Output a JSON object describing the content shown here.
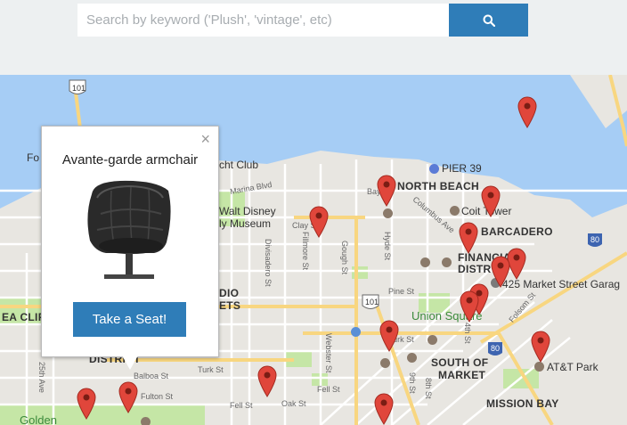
{
  "search": {
    "placeholder": "Search by keyword ('Plush', 'vintage', etc)",
    "button_icon": "search-icon"
  },
  "popup": {
    "title": "Avante-garde armchair",
    "button_label": "Take a Seat!",
    "close_glyph": "×",
    "image_icon": "armchair-image"
  },
  "map": {
    "pin_color": "#e0463b",
    "water_color": "#a6cdf5",
    "park_color": "#c5e6a6",
    "labels": {
      "pier39": "PIER 39",
      "north_beach": "NORTH BEACH",
      "coit_tower": "Coit Tower",
      "embarcadero": "BARCADERO",
      "financial": "FINANCIAL",
      "financial2": "DISTR",
      "market": "425 Market Street Garag",
      "union_square": "Union Square",
      "south_of_market": "SOUTH OF",
      "south_of_market2": "MARKET",
      "att_park": "AT&T Park",
      "mission_bay": "MISSION BAY",
      "walt_disney": "Walt Disney",
      "museum": "ly Museum",
      "yacht_club": "cht Club",
      "marina": "Marina Blvd",
      "clay": "Clay St",
      "pine": "Pine St",
      "turk_left": "Turk St",
      "turk_right": "Turk St",
      "fell_left": "Fell St",
      "fell_right": "Fell St",
      "oak": "Oak St",
      "fulton": "Fulton St",
      "balboa": "Balboa St",
      "divisadero": "Divisadero St",
      "fillmore": "Fillmore St",
      "gough": "Gough St",
      "hyde": "Hyde St",
      "columbus": "Columbus Ave",
      "webster": "Webster St",
      "fourth": "4th St",
      "folsom": "Folsom St",
      "eighth": "8th St",
      "ninth": "9th St",
      "bay": "Bay",
      "s101a": "101",
      "s101b": "101",
      "s80a": "80",
      "s80b": "80",
      "district": "DISTRICT",
      "ea_cliff": "EA CLIFF",
      "fo": "Fo",
      "ave25": "25th Ave",
      "golden": "Golden",
      "dio": "DIO",
      "ets": "ETS",
      "bay_street": "Ba",
      "chestnut": "Chestnut St"
    }
  }
}
